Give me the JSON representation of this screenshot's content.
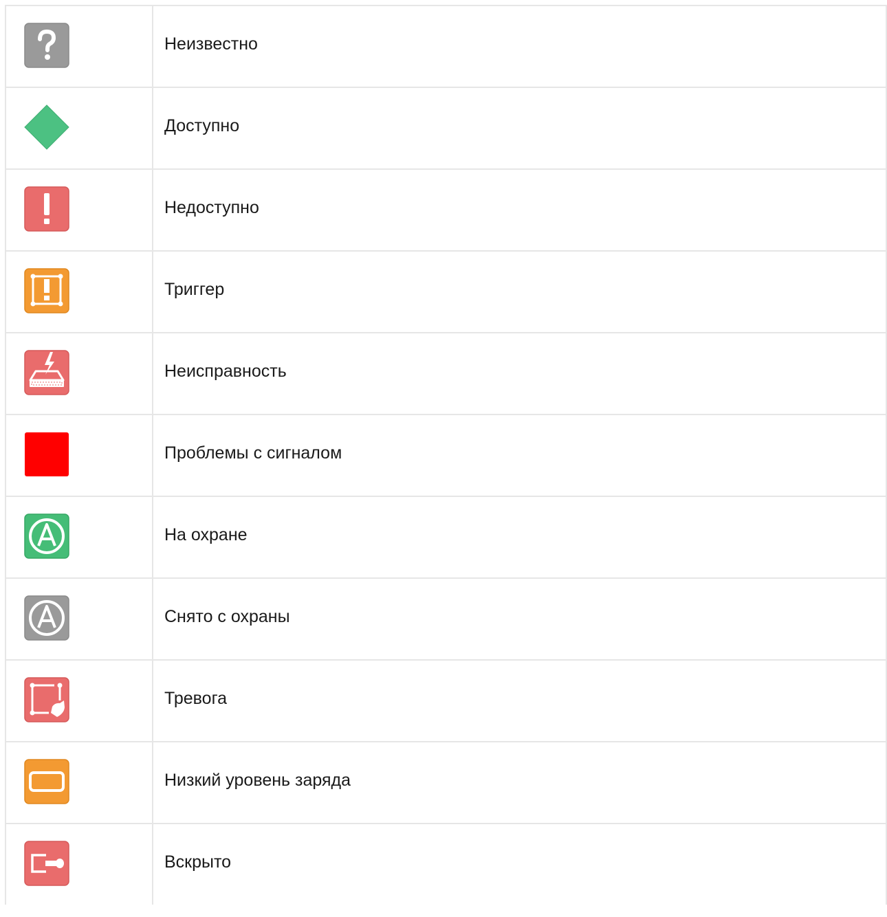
{
  "rows": [
    {
      "icon": "unknown-question-icon",
      "label": "Неизвестно",
      "color": "#9c9c9c"
    },
    {
      "icon": "available-diamond-icon",
      "label": "Доступно",
      "color": "#4cc182"
    },
    {
      "icon": "unavailable-exclamation-icon",
      "label": "Недоступно",
      "color": "#e96c6c"
    },
    {
      "icon": "trigger-icon",
      "label": "Триггер",
      "color": "#f39a32"
    },
    {
      "icon": "malfunction-icon",
      "label": "Неисправность",
      "color": "#e96c6c"
    },
    {
      "icon": "signal-problem-square-icon",
      "label": "Проблемы с сигналом",
      "color": "#ff0000"
    },
    {
      "icon": "armed-icon",
      "label": "На охране",
      "color": "#45bd77"
    },
    {
      "icon": "disarmed-icon",
      "label": "Снято с охраны",
      "color": "#9c9c9c"
    },
    {
      "icon": "alarm-icon",
      "label": "Тревога",
      "color": "#e96c6c"
    },
    {
      "icon": "low-battery-icon",
      "label": "Низкий уровень заряда",
      "color": "#f39a32"
    },
    {
      "icon": "tamper-opened-icon",
      "label": "Вскрыто",
      "color": "#e96c6c"
    }
  ]
}
